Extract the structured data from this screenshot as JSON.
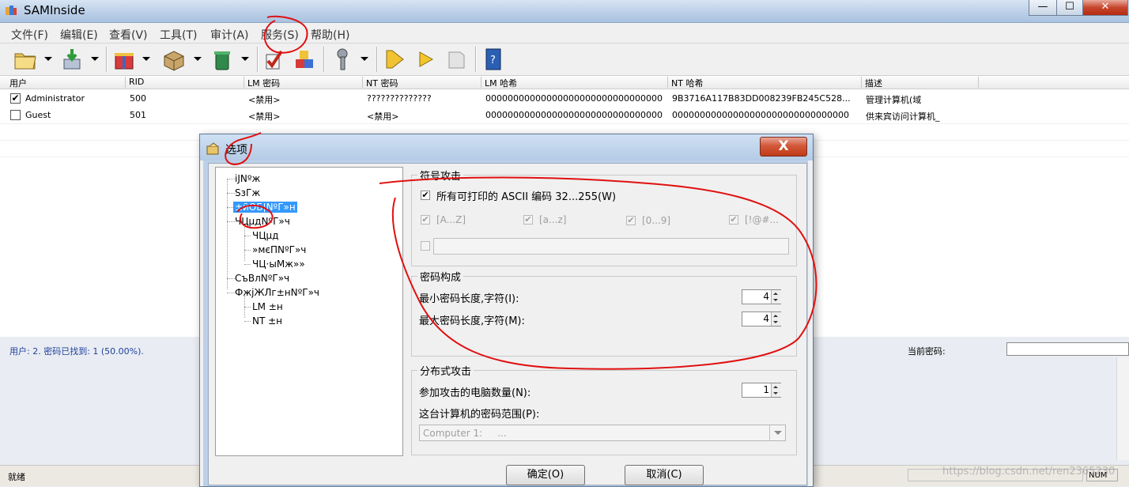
{
  "window": {
    "title": "SAMInside",
    "minimize_glyph": "—",
    "maximize_glyph": "☐",
    "close_glyph": "✕"
  },
  "menu": [
    "文件(F)",
    "编辑(E)",
    "查看(V)",
    "工具(T)",
    "审计(A)",
    "服务(S)",
    "帮助(H)"
  ],
  "toolbar": [
    "open-folder-icon",
    "import-icon",
    "gift-icon",
    "box-icon",
    "trash-icon",
    "check-icon",
    "cubes-icon",
    "wrench-icon",
    "play-icon",
    "play-small-icon",
    "stop-icon",
    "help-book-icon"
  ],
  "list": {
    "columns": [
      "用户",
      "RID",
      "LM 密码",
      "NT 密码",
      "LM 哈希",
      "NT 哈希",
      "描述"
    ],
    "rows": [
      {
        "checked": true,
        "user": "Administrator",
        "rid": "500",
        "lm_password": "<禁用>",
        "nt_password": "??????????????",
        "lm_hash": "00000000000000000000000000000000",
        "nt_hash": "9B3716A117B83DD008239FB245C528...",
        "description": "管理计算机(域"
      },
      {
        "checked": false,
        "user": "Guest",
        "rid": "501",
        "lm_password": "<禁用>",
        "nt_password": "<禁用>",
        "lm_hash": "00000000000000000000000000000000",
        "nt_hash": "00000000000000000000000000000000",
        "description": "供来宾访问计算机_"
      }
    ]
  },
  "summary": "用户: 2. 密码已找到: 1 (50.00%).",
  "current_password_label": "当前密码:",
  "status": {
    "text": "就绪",
    "num": "NUM"
  },
  "watermark": "https://blog.csdn.net/ren2365230",
  "dialog": {
    "title": "选项",
    "close_glyph": "X",
    "tree": [
      "iJNºж",
      "SзГж",
      "±ӣОБ¦NºГ»н",
      "ЧЦµдNºГ»ч",
      "ЧЦµд",
      "»мєПNºГ»ч",
      "ЧЦ·ыМж»»",
      "СъВлNºГ»ч",
      "ФжјЖЛг±нNºГ»ч",
      "LM ±н",
      "NT ±н"
    ],
    "symbol_attack": {
      "title": "符号攻击",
      "all_ascii_label": "所有可打印的 ASCII 编码 32...255(W)",
      "all_ascii_checked": true,
      "charsets": [
        "[A...Z]",
        "[a...z]",
        "[0...9]",
        "[!@#..."
      ]
    },
    "password_composition": {
      "title": "密码构成",
      "min_label": "最小密码长度,字符(I):",
      "min_value": "4",
      "max_label": "最大密码长度,字符(M):",
      "max_value": "4"
    },
    "distributed": {
      "title": "分布式攻击",
      "computers_label": "参加攻击的电脑数量(N):",
      "computers_value": "1",
      "range_label": "这台计算机的密码范围(P):",
      "range_value": "Computer 1:     ..."
    },
    "ok": "确定(O)",
    "cancel": "取消(C)"
  },
  "colors": {
    "annotation": "#e01010",
    "selection": "#3399ff",
    "summary_text": "#1f3f9a"
  }
}
